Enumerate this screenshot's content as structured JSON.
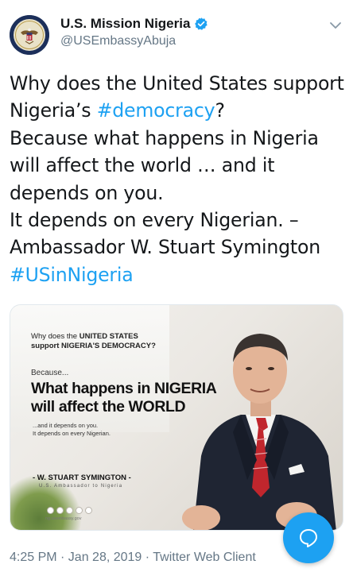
{
  "account": {
    "display_name": "U.S. Mission Nigeria",
    "handle": "@USEmbassyAbuja",
    "verified": true
  },
  "tweet": {
    "lines": [
      {
        "text": "Why does the United States support"
      },
      {
        "pre": "Nigeria’s ",
        "link": "#democracy",
        "post": "?"
      },
      {
        "text": "Because what happens in Nigeria"
      },
      {
        "text": "will affect the world … and it"
      },
      {
        "text": "depends on you."
      },
      {
        "text": "It depends on every Nigerian. –"
      },
      {
        "text": "Ambassador W. Stuart Symington"
      },
      {
        "link": "#USinNigeria"
      }
    ]
  },
  "media": {
    "question_line1_pre": "Why does the ",
    "question_line1_bold": "UNITED STATES",
    "question_line2": "support NIGERIA'S DEMOCRACY?",
    "because": "Because...",
    "big_line1": "What happens in NIGERIA",
    "big_line2": "will affect the WORLD",
    "small_line1": "...and it depends on you.",
    "small_line2": "It depends on every Nigerian.",
    "signature": "- W. STUART SYMINGTON -",
    "signature_title": "U.S. Ambassador to Nigeria",
    "social_url": "ng.usembassy.gov"
  },
  "footer": {
    "meta": "4:25 PM · Jan 28, 2019 · Twitter Web Client"
  },
  "colors": {
    "link": "#1da1f2",
    "secondary_text": "#657786",
    "fab": "#1da1f2"
  },
  "icons": {
    "verified": "verified-badge-icon",
    "caret": "chevron-down-icon",
    "compose": "chat-bubble-icon"
  }
}
